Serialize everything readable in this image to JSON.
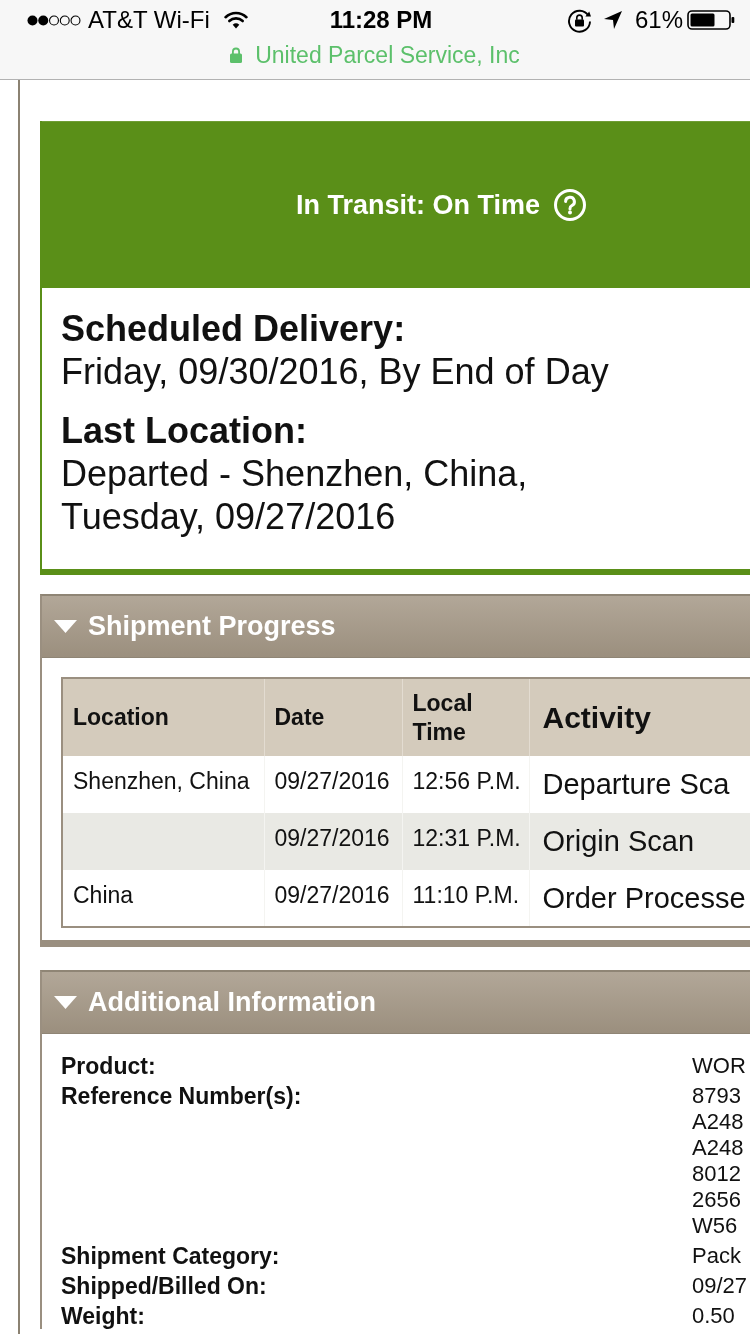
{
  "status_bar": {
    "carrier": "AT&T Wi-Fi",
    "time": "11:28 PM",
    "battery": "61%"
  },
  "browser": {
    "site_name": "United Parcel Service, Inc",
    "secure": true
  },
  "status_card": {
    "status": "In Transit: On Time",
    "details": [
      {
        "heading": "Scheduled Delivery:",
        "lines": [
          "Friday, 09/30/2016, By End of Day"
        ]
      },
      {
        "heading": "Last Location:",
        "lines": [
          "Departed - Shenzhen, China,",
          "Tuesday, 09/27/2016"
        ]
      }
    ]
  },
  "shipment_progress": {
    "title": "Shipment Progress",
    "expanded": true,
    "columns": [
      "Location",
      "Date",
      "Local Time",
      "Activity"
    ],
    "rows": [
      {
        "location": "Shenzhen, China",
        "date": "09/27/2016",
        "local_time": "12:56 P.M.",
        "activity": "Departure Sca"
      },
      {
        "date": "09/27/2016",
        "local_time": "12:31 P.M.",
        "activity": "Origin Scan"
      },
      {
        "location": "China",
        "date": "09/27/2016",
        "local_time": "11:10 P.M.",
        "activity": "Order Processe"
      }
    ]
  },
  "additional_information": {
    "title": "Additional Information",
    "expanded": true,
    "fields": [
      {
        "label": "Product:",
        "values": [
          "WOR"
        ]
      },
      {
        "label": "Reference Number(s):",
        "values": [
          "8793",
          "A248",
          "A248",
          "8012",
          "2656",
          "W56"
        ]
      },
      {
        "label": "Shipment Category:",
        "values": [
          "Pack"
        ]
      },
      {
        "label": "Shipped/Billed On:",
        "values": [
          "09/27"
        ]
      },
      {
        "label": "Weight:",
        "values": [
          "0.50"
        ]
      }
    ]
  }
}
